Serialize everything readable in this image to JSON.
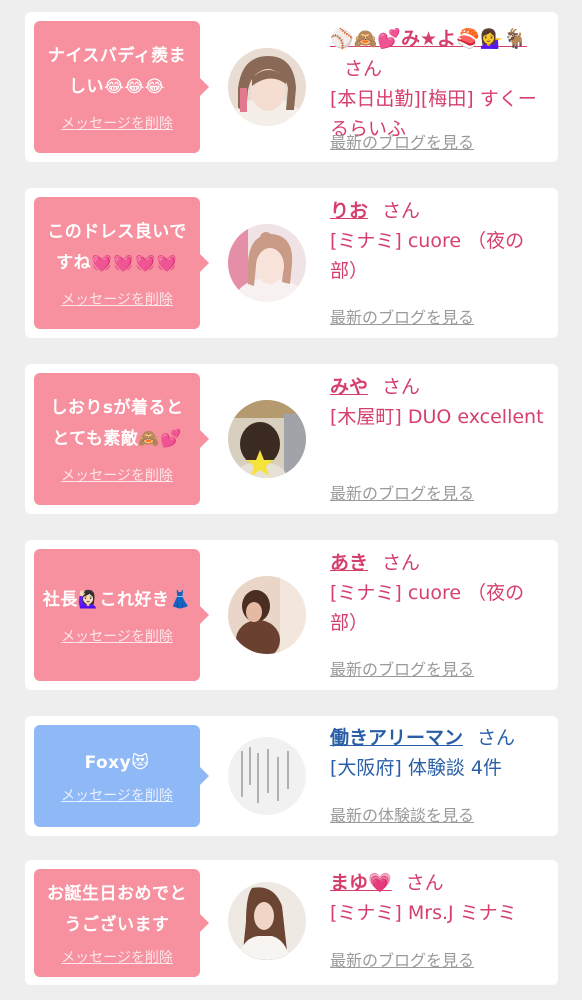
{
  "cards": [
    {
      "theme": "pink",
      "message": "ナイスバディ羨ましい😂😂😂",
      "delete_label": "メッセージを削除",
      "name": "⚾🙈💕み★よ🍣💁‍♀️🐐",
      "san": "さん",
      "shop": "[本日出勤][梅田] すくーるらいふ",
      "link": "最新のブログを見る"
    },
    {
      "theme": "pink",
      "message": "このドレス良いですね💓💓💓💓",
      "delete_label": "メッセージを削除",
      "name": "りお",
      "san": "さん",
      "shop": "[ミナミ] cuore （夜の部）",
      "link": "最新のブログを見る"
    },
    {
      "theme": "pink",
      "message": "しおりsが着るととても素敵🙈💕",
      "delete_label": "メッセージを削除",
      "name": "みや",
      "san": "さん",
      "shop": "[木屋町] DUO excellent",
      "link": "最新のブログを見る"
    },
    {
      "theme": "pink",
      "message": "社長🙋🏻‍♀️これ好き👗",
      "delete_label": "メッセージを削除",
      "name": "あき",
      "san": "さん",
      "shop": "[ミナミ] cuore （夜の部）",
      "link": "最新のブログを見る"
    },
    {
      "theme": "blue",
      "message": "Foxy😻",
      "delete_label": "メッセージを削除",
      "name": "働きアリーマン",
      "san": "さん",
      "shop": "[大阪府] 体験談 4件",
      "link": "最新の体験談を見る"
    },
    {
      "theme": "pink",
      "message": "お誕生日おめでとうございます",
      "delete_label": "メッセージを削除",
      "name": "まゆ💗",
      "san": "さん",
      "shop": "[ミナミ] Mrs.J ミナミ",
      "link": "最新のブログを見る"
    }
  ],
  "colors": {
    "pink_bubble": "#f7909f",
    "blue_bubble": "#8fb8f7",
    "pink_text": "#d63f6c",
    "blue_text": "#2a5fa8",
    "link_gray": "#9a9a9a"
  }
}
